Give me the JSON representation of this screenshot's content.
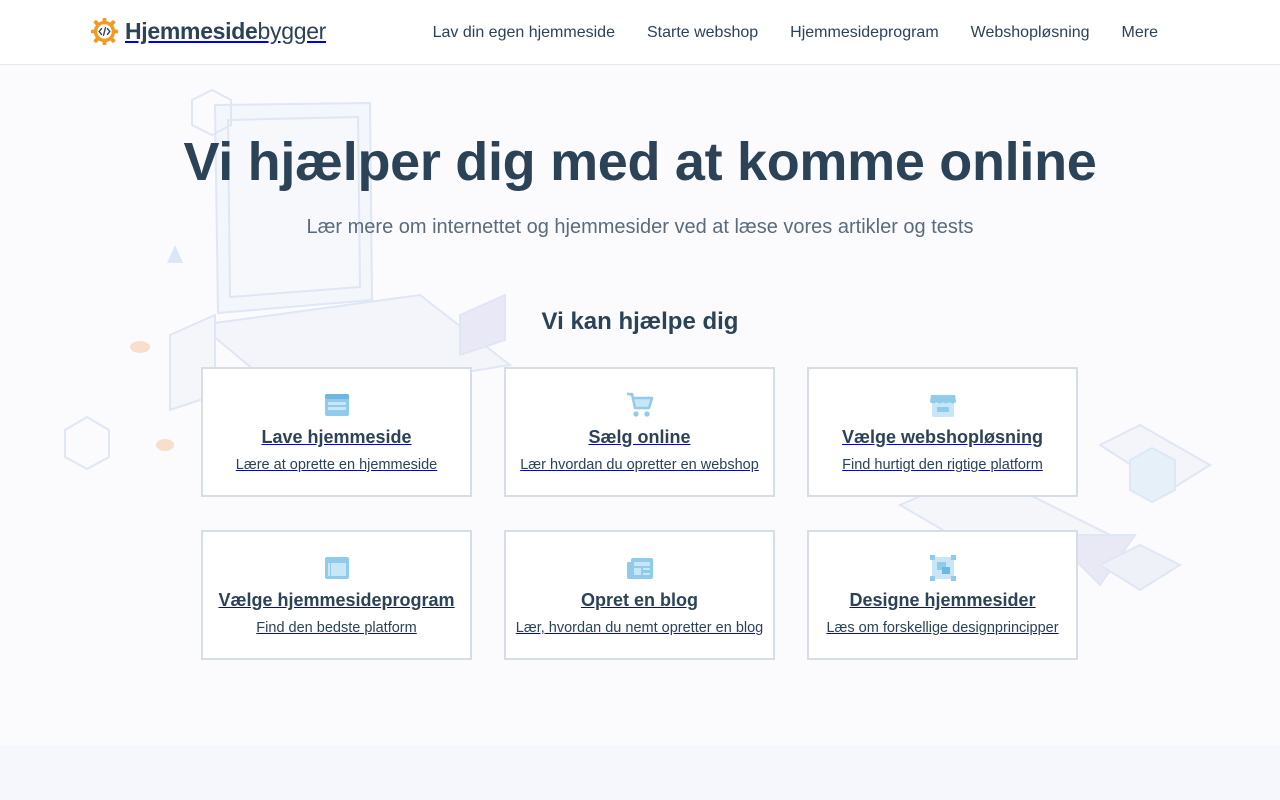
{
  "header": {
    "logo_bold": "Hjemmeside",
    "logo_light": "bygger",
    "nav": [
      {
        "label": "Lav din egen hjemmeside"
      },
      {
        "label": "Starte webshop"
      },
      {
        "label": "Hjemmesideprogram"
      },
      {
        "label": "Webshopløsning"
      },
      {
        "label": "Mere"
      }
    ]
  },
  "hero": {
    "title": "Vi hjælper dig med at komme online",
    "subtitle": "Lær mere om internettet og hjemmesider ved at læse vores artikler og tests"
  },
  "help": {
    "title": "Vi kan hjælpe dig",
    "cards": [
      {
        "icon": "browser-window-icon",
        "title": "Lave hjemmeside",
        "desc": "Lære at oprette en hjemmeside"
      },
      {
        "icon": "shopping-cart-icon",
        "title": "Sælg online",
        "desc": "Lær hvordan du opretter en webshop"
      },
      {
        "icon": "storefront-icon",
        "title": "Vælge webshopløsning",
        "desc": "Find hurtigt den rigtige platform"
      },
      {
        "icon": "layout-icon",
        "title": "Vælge hjemmesideprogram",
        "desc": "Find den bedste platform"
      },
      {
        "icon": "newspaper-icon",
        "title": "Opret en blog",
        "desc": "Lær, hvordan du nemt opretter en blog"
      },
      {
        "icon": "design-frame-icon",
        "title": "Designe hjemmesider",
        "desc": "Læs om forskellige designprincipper"
      }
    ]
  },
  "colors": {
    "text": "#2b4257",
    "accent_orange": "#f39a1e",
    "icon_blue": "#8fcbeb",
    "card_border": "#d5dee7"
  }
}
